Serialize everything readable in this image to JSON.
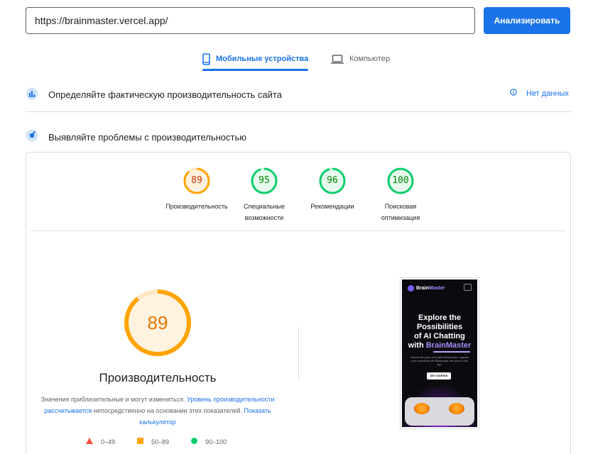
{
  "search": {
    "url": "https://brainmaster.vercel.app/",
    "analyze_label": "Анализировать"
  },
  "tabs": [
    {
      "label": "Мобильные устройства",
      "icon": "smartphone-icon",
      "active": true
    },
    {
      "label": "Компьютер",
      "icon": "laptop-icon",
      "active": false
    }
  ],
  "field_data": {
    "title": "Определяйте фактическую производительность сайта",
    "no_data_label": "Нет данных"
  },
  "diagnose": {
    "title": "Выявляйте проблемы с производительностью"
  },
  "categories": [
    {
      "score": 89,
      "label": "Производительность",
      "status": "average",
      "color": "#ffa400"
    },
    {
      "score": 95,
      "label": "Специальные возможности",
      "status": "pass",
      "color": "#0cce6b"
    },
    {
      "score": 96,
      "label": "Рекомендации",
      "status": "pass",
      "color": "#0cce6b"
    },
    {
      "score": 100,
      "label": "Поисковая оптимизация",
      "status": "pass",
      "color": "#0cce6b"
    }
  ],
  "performance": {
    "score": 89,
    "title": "Производительность",
    "desc_text1": "Значения приблизительные и могут изменяться.",
    "desc_link1": "Уровень производительности рассчитывается",
    "desc_text2": "непосредственно на основании этих показателей.",
    "desc_link2": "Показать калькулятор"
  },
  "legend": [
    {
      "range": "0–49",
      "shape": "triangle",
      "color": "#ff4e42"
    },
    {
      "range": "50–89",
      "shape": "square",
      "color": "#ffa400"
    },
    {
      "range": "90–100",
      "shape": "circle",
      "color": "#0cce6b"
    }
  ],
  "screenshot": {
    "brand": "Brain",
    "brand_accent": "Master",
    "headline_lines": [
      "Explore the",
      "Possibilities",
      "of AI Chatting",
      "with "
    ],
    "headline_accent": "BrainMaster",
    "subtext": "Unleash the power of AI within Brainmaster. Upgrade your productivity with Brainmaster, the open AI chat app.",
    "button": "GET STARTED"
  },
  "colors": {
    "accent": "#1a73e8",
    "average": "#ffa400",
    "pass": "#0cce6b",
    "fail": "#ff4e42"
  }
}
